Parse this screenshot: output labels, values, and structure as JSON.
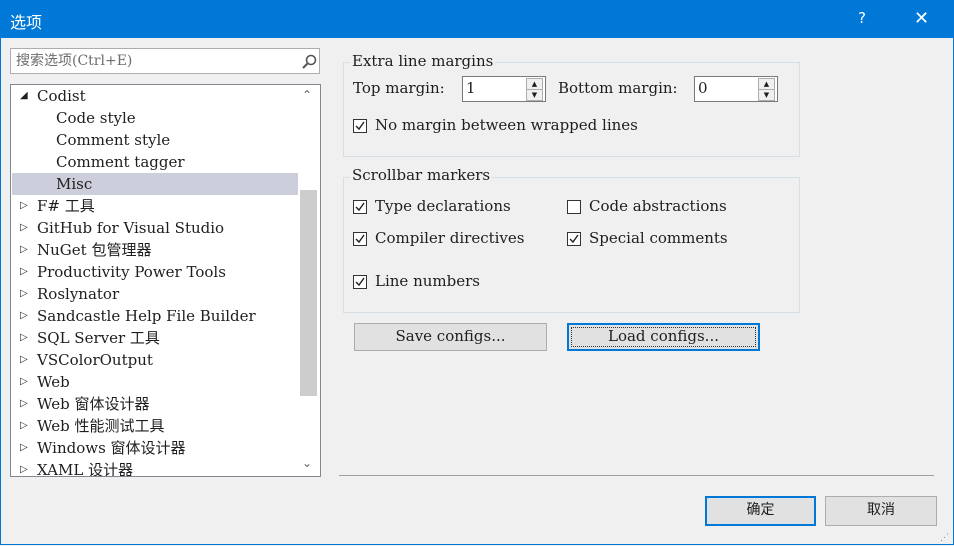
{
  "window": {
    "title": "选项",
    "help": "?",
    "close": "✕"
  },
  "search": {
    "placeholder": "搜索选项(Ctrl+E)"
  },
  "tree": {
    "items": [
      {
        "label": "Codist",
        "expanded": true
      },
      {
        "label": "Code style"
      },
      {
        "label": "Comment style"
      },
      {
        "label": "Comment tagger"
      },
      {
        "label": "Misc",
        "selected": true
      },
      {
        "label": "F# 工具"
      },
      {
        "label": "GitHub for Visual Studio"
      },
      {
        "label": "NuGet 包管理器"
      },
      {
        "label": "Productivity Power Tools"
      },
      {
        "label": "Roslynator"
      },
      {
        "label": "Sandcastle Help File Builder"
      },
      {
        "label": "SQL Server 工具"
      },
      {
        "label": "VSColorOutput"
      },
      {
        "label": "Web"
      },
      {
        "label": "Web 窗体设计器"
      },
      {
        "label": "Web 性能测试工具"
      },
      {
        "label": "Windows 窗体设计器"
      },
      {
        "label": "XAML 设计器"
      }
    ]
  },
  "margins": {
    "group_label": "Extra line margins",
    "top_label": "Top margin:",
    "top_value": "1",
    "bottom_label": "Bottom margin:",
    "bottom_value": "0",
    "no_margin_label": "No margin between wrapped lines",
    "no_margin_checked": true
  },
  "markers": {
    "group_label": "Scrollbar markers",
    "type_declarations": "Type declarations",
    "code_abstractions": "Code abstractions",
    "compiler_directives": "Compiler directives",
    "special_comments": "Special comments",
    "line_numbers": "Line numbers"
  },
  "buttons": {
    "save_configs": "Save configs...",
    "load_configs": "Load configs...",
    "ok": "确定",
    "cancel": "取消"
  },
  "colors": {
    "accent": "#0078d7",
    "selected": "#cccedb"
  }
}
